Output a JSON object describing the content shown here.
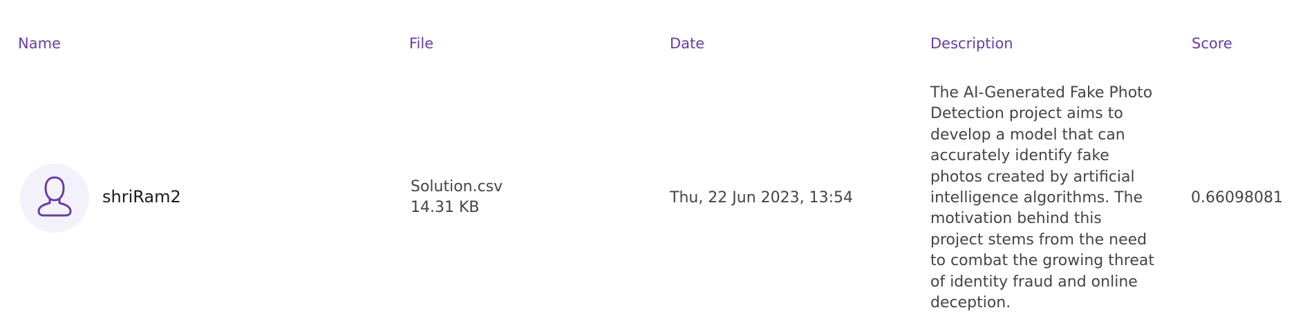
{
  "headers": {
    "name": "Name",
    "file": "File",
    "date": "Date",
    "description": "Description",
    "score": "Score"
  },
  "rows": [
    {
      "username": "shriRam2",
      "avatar_icon": "user-icon",
      "file_name": "Solution.csv",
      "file_size": "14.31 KB",
      "date": "Thu, 22 Jun 2023, 13:54",
      "description": "The AI-Generated Fake Photo Detection project aims to develop a model that can accurately identify fake photos created by artificial intelligence algorithms. The motivation behind this project stems from the need to combat the growing threat of identity fraud and online deception.",
      "score": "0.66098081"
    }
  ],
  "colors": {
    "header": "#6a3aa6",
    "avatar_bg": "#f3f2fb",
    "avatar_icon": "#6a3aa6",
    "text": "#444444",
    "username": "#1a1a1a"
  }
}
